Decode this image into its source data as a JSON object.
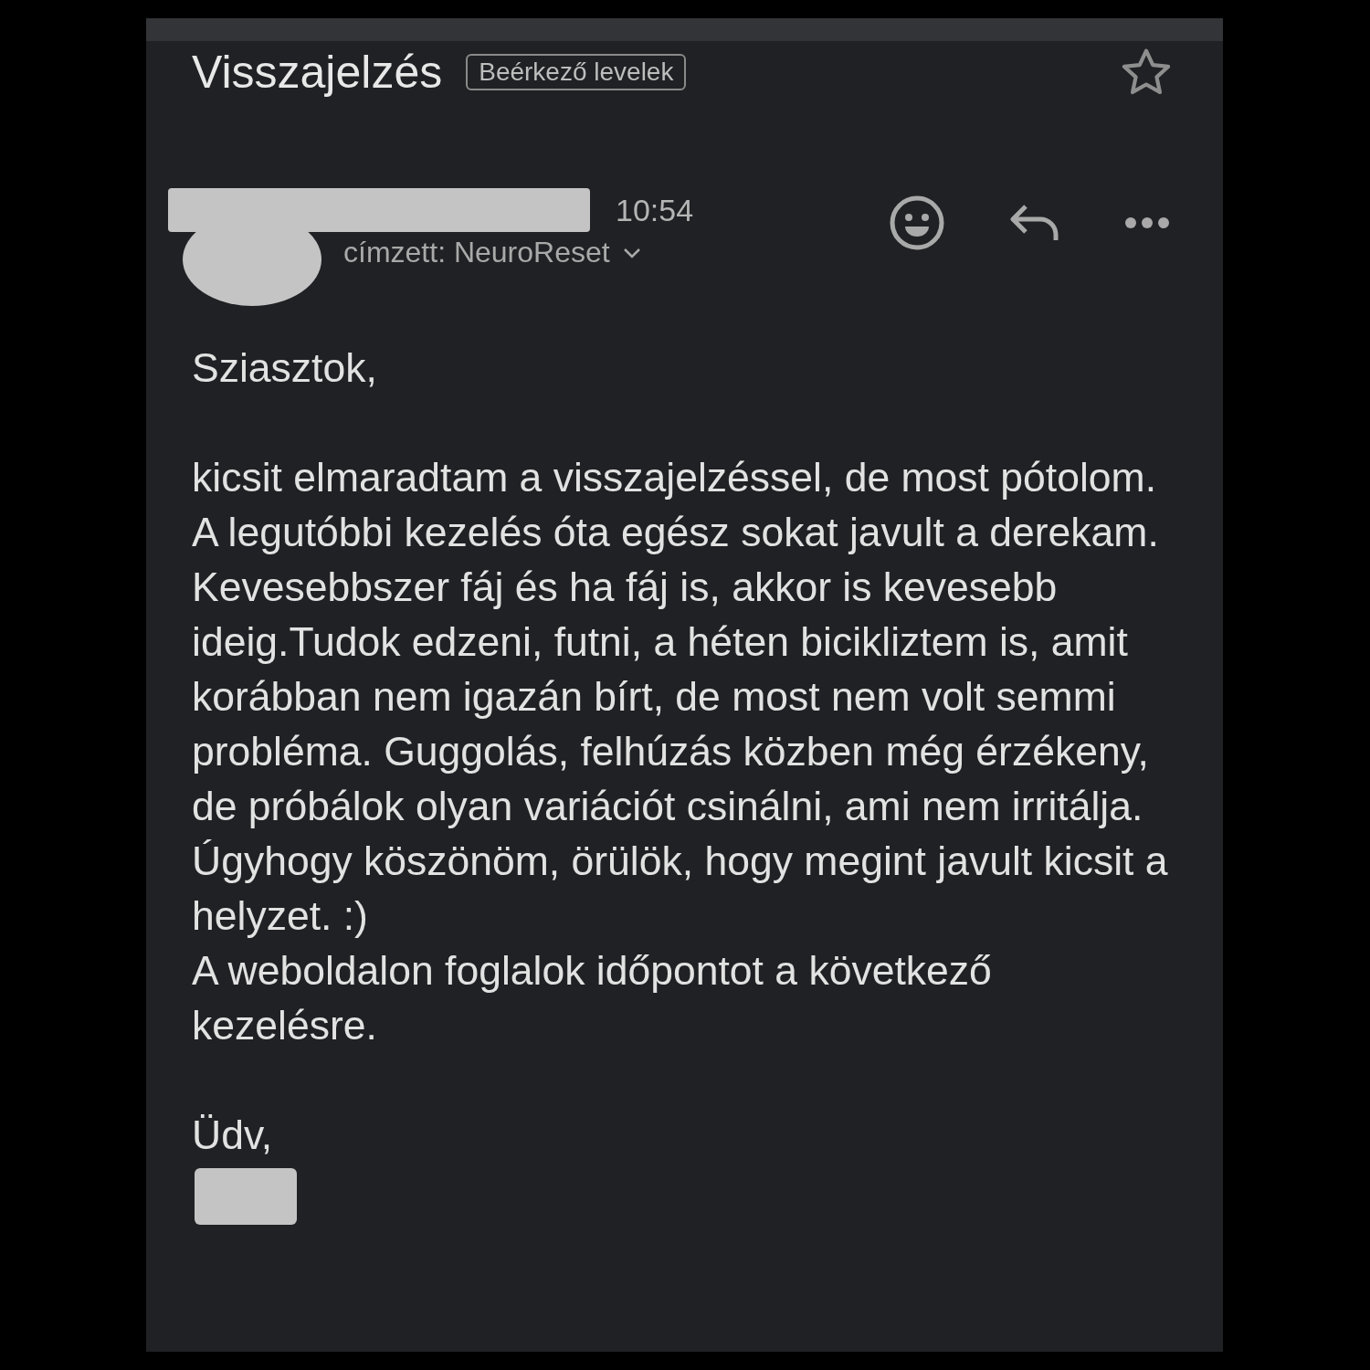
{
  "header": {
    "title": "Visszajelzés",
    "label": "Beérkező levelek",
    "starred": false
  },
  "message": {
    "time": "10:54",
    "recipient": "címzett: NeuroReset",
    "greeting": "Sziasztok,",
    "paragraphs": [
      "kicsit elmaradtam a visszajelzéssel, de most pótolom.",
      "A legutóbbi kezelés óta egész sokat javult a derekam. Kevesebbszer fáj és ha fáj is, akkor is kevesebb ideig.Tudok edzeni, futni, a héten bicikliztem is, amit korábban nem igazán bírt, de most nem volt semmi probléma. Guggolás, felhúzás közben még érzékeny, de próbálok olyan variációt csinálni, ami nem irritálja.",
      "Úgyhogy köszönöm, örülök, hogy megint javult kicsit a helyzet. :)",
      "A weboldalon foglalok időpontot a következő kezelésre."
    ],
    "closing": "Üdv,"
  }
}
